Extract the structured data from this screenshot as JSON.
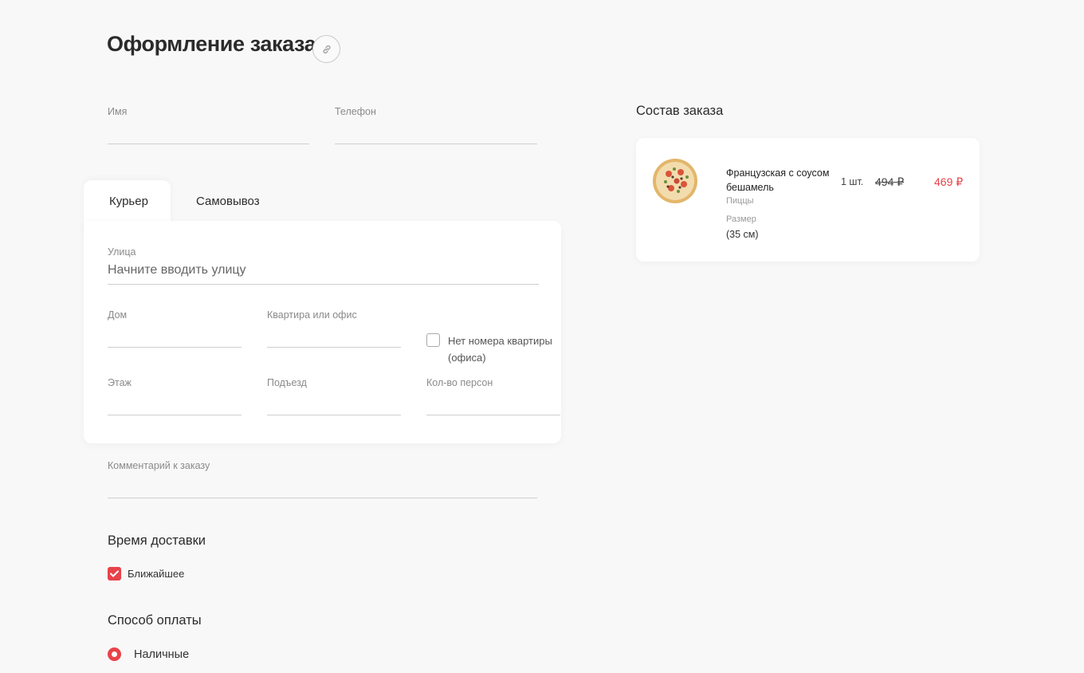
{
  "page": {
    "title": "Оформление заказа",
    "link_icon": "link-icon"
  },
  "contact": {
    "name_label": "Имя",
    "name_value": "",
    "phone_label": "Телефон",
    "phone_value": ""
  },
  "delivery_tabs": {
    "courier": "Курьер",
    "pickup": "Самовывоз",
    "active": "courier"
  },
  "address": {
    "street_label": "Улица",
    "street_placeholder": "Начните вводить улицу",
    "house_label": "Дом",
    "apartment_label": "Квартира или офис",
    "no_apartment_label": "Нет номера квартиры (офиса)",
    "no_apartment_checked": false,
    "floor_label": "Этаж",
    "entrance_label": "Подъезд",
    "persons_label": "Кол-во персон"
  },
  "comment": {
    "label": "Комментарий к заказу",
    "value": ""
  },
  "delivery_time": {
    "heading": "Время доставки",
    "option_label": "Ближайшее",
    "option_checked": true
  },
  "payment": {
    "heading": "Способ оплаты",
    "option_label": "Наличные",
    "selected": true
  },
  "order": {
    "heading": "Состав заказа",
    "items": [
      {
        "name": "Французская с соусом бешамель",
        "category": "Пиццы",
        "size_label": "Размер",
        "size_value": "(35 см)",
        "quantity": "1 шт.",
        "old_price": "494 ₽",
        "new_price": "469 ₽"
      }
    ]
  },
  "colors": {
    "accent": "#e8424a",
    "background": "#f8f8f8",
    "card": "#ffffff"
  }
}
